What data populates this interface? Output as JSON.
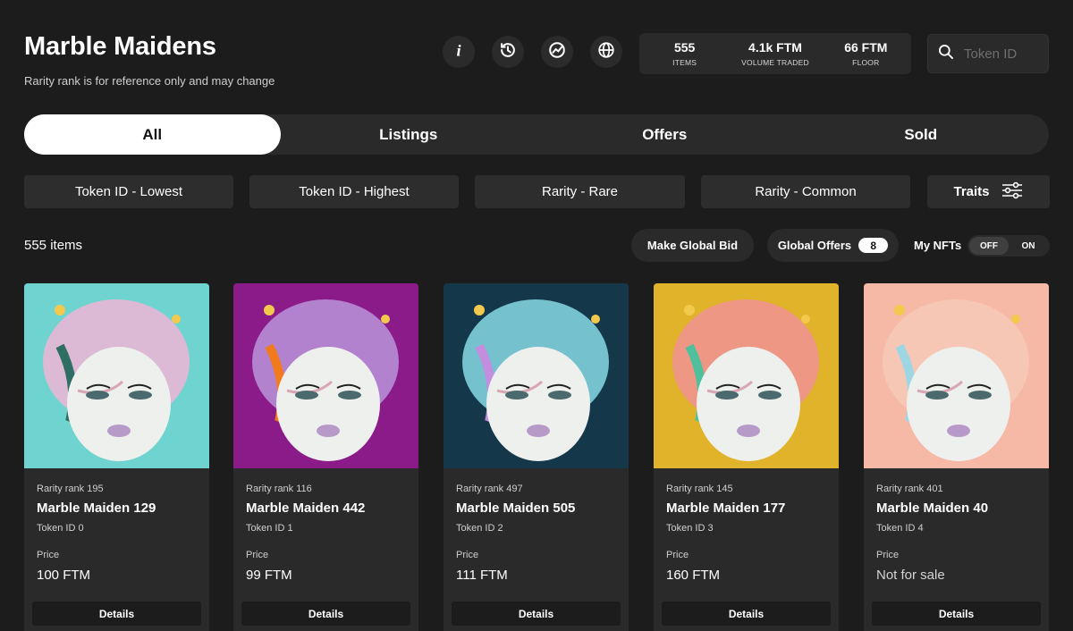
{
  "header": {
    "title": "Marble Maidens",
    "subtitle": "Rarity rank is for reference only and may change"
  },
  "header_icons": [
    "info-icon",
    "history-icon",
    "chart-icon",
    "globe-icon"
  ],
  "stats": [
    {
      "value": "555",
      "label": "ITEMS"
    },
    {
      "value": "4.1k FTM",
      "label": "VOLUME TRADED"
    },
    {
      "value": "66 FTM",
      "label": "FLOOR"
    }
  ],
  "search": {
    "placeholder": "Token ID",
    "value": ""
  },
  "tabs": [
    {
      "label": "All",
      "active": true
    },
    {
      "label": "Listings",
      "active": false
    },
    {
      "label": "Offers",
      "active": false
    },
    {
      "label": "Sold",
      "active": false
    }
  ],
  "sort_options": [
    "Token ID - Lowest",
    "Token ID - Highest",
    "Rarity - Rare",
    "Rarity - Common"
  ],
  "traits_label": "Traits",
  "item_count": "555 items",
  "actions": {
    "make_global_bid": "Make Global Bid",
    "global_offers": "Global Offers",
    "global_offers_count": "8",
    "my_nfts_label": "My NFTs",
    "toggle_off": "OFF",
    "toggle_on": "ON",
    "toggle_selected": "OFF"
  },
  "colors": {
    "background": "#1c1c1c",
    "card": "#2a2a2a",
    "active_tab": "#ffffff"
  },
  "cards": [
    {
      "rarity": "Rarity rank 195",
      "name": "Marble Maiden 129",
      "token": "Token ID 0",
      "price_label": "Price",
      "price": "100 FTM",
      "details": "Details",
      "bg": "#6fd4cf",
      "hair": "#e8b7d6",
      "accent": "#2f6f63"
    },
    {
      "rarity": "Rarity rank 116",
      "name": "Marble Maiden 442",
      "token": "Token ID 1",
      "price_label": "Price",
      "price": "99 FTM",
      "details": "Details",
      "bg": "#8c1b8a",
      "hair": "#b78ed6",
      "accent": "#f07a1c"
    },
    {
      "rarity": "Rarity rank 497",
      "name": "Marble Maiden 505",
      "token": "Token ID 2",
      "price_label": "Price",
      "price": "111 FTM",
      "details": "Details",
      "bg": "#14374a",
      "hair": "#7fd0dc",
      "accent": "#c38de0"
    },
    {
      "rarity": "Rarity rank 145",
      "name": "Marble Maiden 177",
      "token": "Token ID 3",
      "price_label": "Price",
      "price": "160 FTM",
      "details": "Details",
      "bg": "#e0b32a",
      "hair": "#f0948f",
      "accent": "#4fbf9c"
    },
    {
      "rarity": "Rarity rank 401",
      "name": "Marble Maiden 40",
      "token": "Token ID 4",
      "price_label": "Price",
      "price": "Not for sale",
      "details": "Details",
      "bg": "#f6b9a6",
      "hair": "#f7c9b8",
      "accent": "#9ed6e3"
    }
  ]
}
